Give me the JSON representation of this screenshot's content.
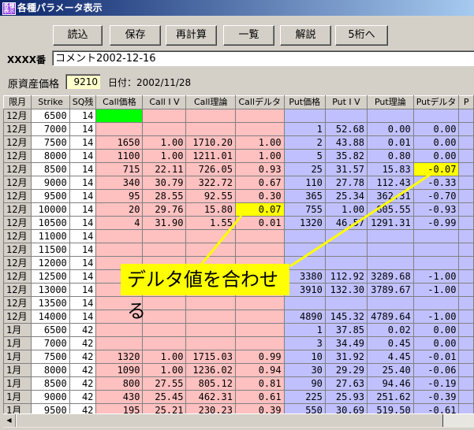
{
  "window": {
    "title": "各種パラメータ表示",
    "icon": "app-icon"
  },
  "toolbar": {
    "buttons": [
      "読込",
      "保存",
      "再計算",
      "一覧",
      "解説",
      "5桁へ"
    ]
  },
  "comment": {
    "label": "XXXX番",
    "value": "コメント2002-12-16"
  },
  "underlying": {
    "label": "原資産価格",
    "value": "9210",
    "date": "日付：2002/11/28"
  },
  "grid": {
    "columns": [
      "限月",
      "Strike",
      "SQ残",
      "Call価格",
      "Call I V",
      "Call理論",
      "Callデルタ",
      "Put価格",
      "Put I V",
      "Put理論",
      "Putデルタ",
      "P"
    ],
    "rows": [
      [
        "12月",
        "6500",
        "14",
        "",
        "",
        "",
        "",
        "",
        "",
        "",
        "",
        ""
      ],
      [
        "12月",
        "7000",
        "14",
        "",
        "",
        "",
        "",
        "1",
        "52.68",
        "0.00",
        "0.00",
        ""
      ],
      [
        "12月",
        "7500",
        "14",
        "1650",
        "1.00",
        "1710.20",
        "1.00",
        "2",
        "43.88",
        "0.01",
        "0.00",
        ""
      ],
      [
        "12月",
        "8000",
        "14",
        "1100",
        "1.00",
        "1211.01",
        "1.00",
        "5",
        "35.82",
        "0.80",
        "0.00",
        ""
      ],
      [
        "12月",
        "8500",
        "14",
        "715",
        "22.11",
        "726.05",
        "0.93",
        "25",
        "31.57",
        "15.83",
        "-0.07",
        ""
      ],
      [
        "12月",
        "9000",
        "14",
        "340",
        "30.79",
        "322.72",
        "0.67",
        "110",
        "27.78",
        "112.43",
        "-0.33",
        ""
      ],
      [
        "12月",
        "9500",
        "14",
        "95",
        "28.55",
        "92.55",
        "0.30",
        "365",
        "25.34",
        "362.31",
        "-0.70",
        ""
      ],
      [
        "12月",
        "10000",
        "14",
        "20",
        "29.76",
        "15.80",
        "0.07",
        "755",
        "1.00",
        "805.55",
        "-0.93",
        ""
      ],
      [
        "12月",
        "10500",
        "14",
        "4",
        "31.90",
        "1.55",
        "0.01",
        "1320",
        "46.57",
        "1291.31",
        "-0.99",
        ""
      ],
      [
        "12月",
        "11000",
        "14",
        "",
        "",
        "",
        "",
        "",
        "",
        "",
        "",
        ""
      ],
      [
        "12月",
        "11500",
        "14",
        "",
        "",
        "",
        "",
        "",
        "",
        "",
        "",
        ""
      ],
      [
        "12月",
        "12000",
        "14",
        "",
        "",
        "",
        "",
        "",
        "",
        "",
        "",
        ""
      ],
      [
        "12月",
        "12500",
        "14",
        "",
        "",
        "",
        "",
        "3380",
        "112.92",
        "3289.68",
        "-1.00",
        ""
      ],
      [
        "12月",
        "13000",
        "14",
        "",
        "",
        "",
        "",
        "3910",
        "132.30",
        "3789.67",
        "-1.00",
        ""
      ],
      [
        "12月",
        "13500",
        "14",
        "",
        "",
        "",
        "",
        "",
        "",
        "",
        "",
        ""
      ],
      [
        "12月",
        "14000",
        "14",
        "",
        "",
        "",
        "",
        "4890",
        "145.32",
        "4789.64",
        "-1.00",
        ""
      ],
      [
        "1月",
        "6500",
        "42",
        "",
        "",
        "",
        "",
        "1",
        "37.85",
        "0.02",
        "0.00",
        ""
      ],
      [
        "1月",
        "7000",
        "42",
        "",
        "",
        "",
        "",
        "3",
        "34.49",
        "0.45",
        "0.00",
        ""
      ],
      [
        "1月",
        "7500",
        "42",
        "1320",
        "1.00",
        "1715.03",
        "0.99",
        "10",
        "31.92",
        "4.45",
        "-0.01",
        ""
      ],
      [
        "1月",
        "8000",
        "42",
        "1090",
        "1.00",
        "1236.02",
        "0.94",
        "30",
        "29.29",
        "25.40",
        "-0.06",
        ""
      ],
      [
        "1月",
        "8500",
        "42",
        "800",
        "27.55",
        "805.12",
        "0.81",
        "90",
        "27.63",
        "94.46",
        "-0.19",
        ""
      ],
      [
        "1月",
        "9000",
        "42",
        "430",
        "25.45",
        "462.31",
        "0.61",
        "225",
        "25.93",
        "251.62",
        "-0.39",
        ""
      ],
      [
        "1月",
        "9500",
        "42",
        "195",
        "25.21",
        "230.23",
        "0.39",
        "550",
        "30.69",
        "519.50",
        "-0.61",
        ""
      ]
    ]
  },
  "annotation": {
    "text": "デルタ値を合わせる"
  },
  "colors": {
    "call": "#ffc0c0",
    "put": "#c0c0ff",
    "highlight": "#ffff00",
    "green": "#00ff00"
  }
}
